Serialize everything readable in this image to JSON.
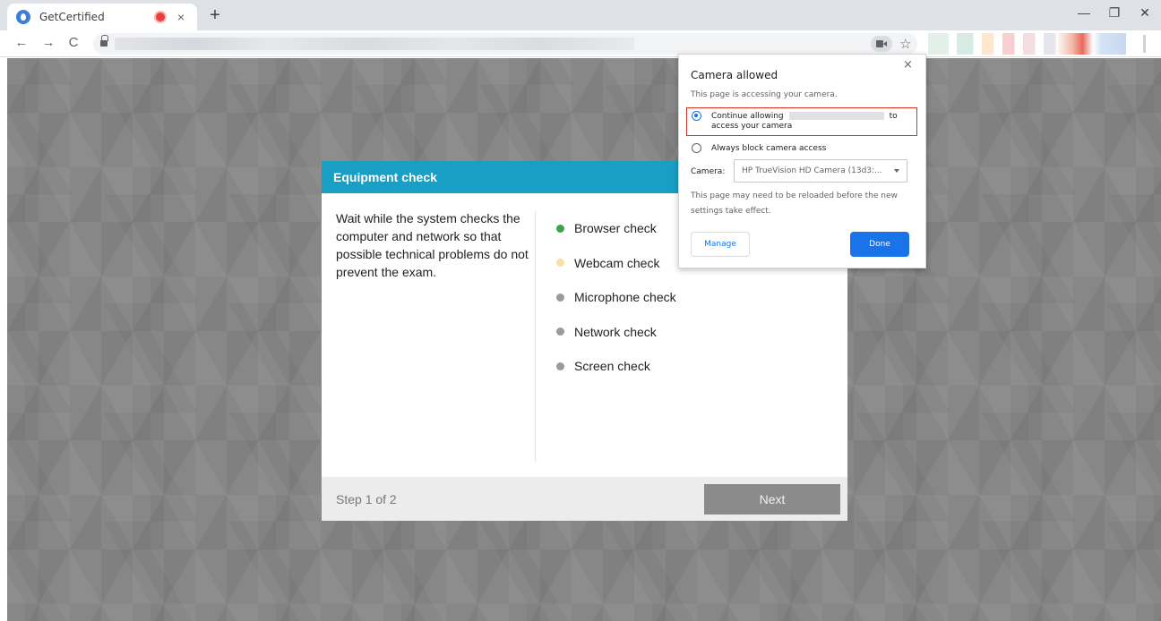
{
  "browser": {
    "tab": {
      "title": "GetCertified",
      "close_glyph": "×",
      "favicon": "getcertified-logo-icon",
      "recording_indicator": "recording-dot-icon"
    },
    "new_tab_glyph": "+",
    "window_controls": {
      "minimize": "—",
      "restore": "❐",
      "close": "✕"
    },
    "nav": {
      "back": "←",
      "forward": "→",
      "reload": "C",
      "star": "☆"
    }
  },
  "modal": {
    "title": "Equipment check",
    "description": "Wait while the system checks the computer and network so that possible technical problems do not prevent the exam.",
    "checks": [
      {
        "label": "Browser check",
        "status": "done",
        "color": "#3fa34d"
      },
      {
        "label": "Webcam check",
        "status": "in-progress",
        "color": "#f8dfa8"
      },
      {
        "label": "Microphone check",
        "status": "pending",
        "color": "#9a9a9a"
      },
      {
        "label": "Network check",
        "status": "pending",
        "color": "#9a9a9a"
      },
      {
        "label": "Screen check",
        "status": "pending",
        "color": "#9a9a9a"
      }
    ],
    "step": "Step 1 of 2",
    "next_label": "Next"
  },
  "camera_popup": {
    "close_glyph": "×",
    "title": "Camera allowed",
    "subtitle": "This page is accessing your camera.",
    "option_allow_prefix": "Continue allowing",
    "option_allow_suffix": "to",
    "option_allow_line2": "access your camera",
    "option_block": "Always block camera access",
    "camera_label": "Camera:",
    "camera_value": "HP TrueVision HD Camera (13d3:...",
    "note": "This page may need to be reloaded before the new settings take effect.",
    "manage_label": "Manage",
    "done_label": "Done",
    "selected_option": "allow"
  },
  "colors": {
    "header_blue": "#1a9fc4",
    "primary_blue": "#1a73e8",
    "highlight_red": "#d93025"
  }
}
